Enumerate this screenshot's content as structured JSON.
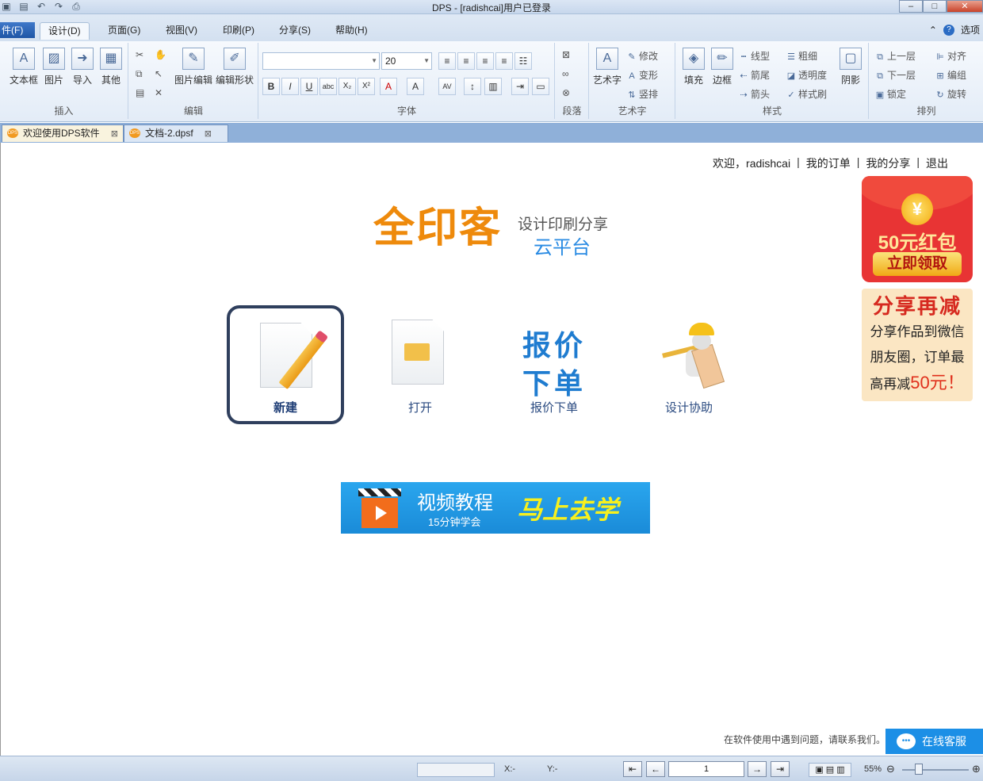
{
  "window": {
    "title": "DPS - [radishcai]用户已登录",
    "quick_access": [
      "open-icon",
      "save-icon",
      "undo-icon",
      "redo-icon",
      "print-icon"
    ]
  },
  "menu": {
    "file": "件(F)",
    "tabs": [
      "设计(D)",
      "页面(G)",
      "视图(V)",
      "印刷(P)",
      "分享(S)",
      "帮助(H)"
    ],
    "options": "选项"
  },
  "ribbon": {
    "insert": {
      "label": "插入",
      "buttons": [
        "文本框",
        "图片",
        "导入",
        "其他"
      ]
    },
    "edit": {
      "label": "编辑",
      "buttons": [
        "图片编辑",
        "编辑形状"
      ]
    },
    "font": {
      "label": "字体",
      "font_name": "",
      "font_size": "20"
    },
    "paragraph": {
      "label": "段落"
    },
    "arttext": {
      "label": "艺术字",
      "big": "艺术字",
      "items": [
        "修改",
        "变形",
        "竖排"
      ]
    },
    "style": {
      "label": "样式",
      "big": [
        "填充",
        "边框"
      ],
      "items": [
        "线型",
        "粗细",
        "箭尾",
        "透明度",
        "箭头",
        "样式刷"
      ],
      "shadow": "阴影"
    },
    "arrange": {
      "label": "排列",
      "items": [
        "上一层",
        "对齐",
        "下一层",
        "编组",
        "锁定",
        "旋转"
      ]
    }
  },
  "doc_tabs": [
    {
      "label": "欢迎使用DPS软件",
      "active": true
    },
    {
      "label": "文档-2.dpsf",
      "active": false
    }
  ],
  "header_links": {
    "welcome": "欢迎，radishcai",
    "orders": "我的订单",
    "shares": "我的分享",
    "logout": "退出"
  },
  "logo": {
    "brand": "全印客",
    "tagline_1": "设计印刷分享",
    "tagline_2": "云平台"
  },
  "actions": {
    "new": "新建",
    "open": "打开",
    "quote_big_1": "报价",
    "quote_big_2": "下单",
    "quote": "报价下单",
    "design_help": "设计协助"
  },
  "promo": {
    "coin": "¥",
    "amount": "50元红包",
    "claim": "立即领取",
    "share_title": "分享再减",
    "share_line1": "分享作品到微信",
    "share_line2": "朋友圈，订单最",
    "share_line3_prefix": "高再减",
    "share_line3_highlight": "50元！"
  },
  "video": {
    "title": "视频教程",
    "subtitle": "15分钟学会",
    "cta": "马上去学"
  },
  "support": {
    "note": "在软件使用中遇到问题，请联系我们。",
    "button": "在线客服"
  },
  "status": {
    "x_label": "X:-",
    "y_label": "Y:-",
    "page": "1",
    "zoom": "55%"
  },
  "colors": {
    "brand_orange": "#ee8a0c",
    "accent_blue": "#1f7cd0",
    "promo_red": "#e83434"
  }
}
